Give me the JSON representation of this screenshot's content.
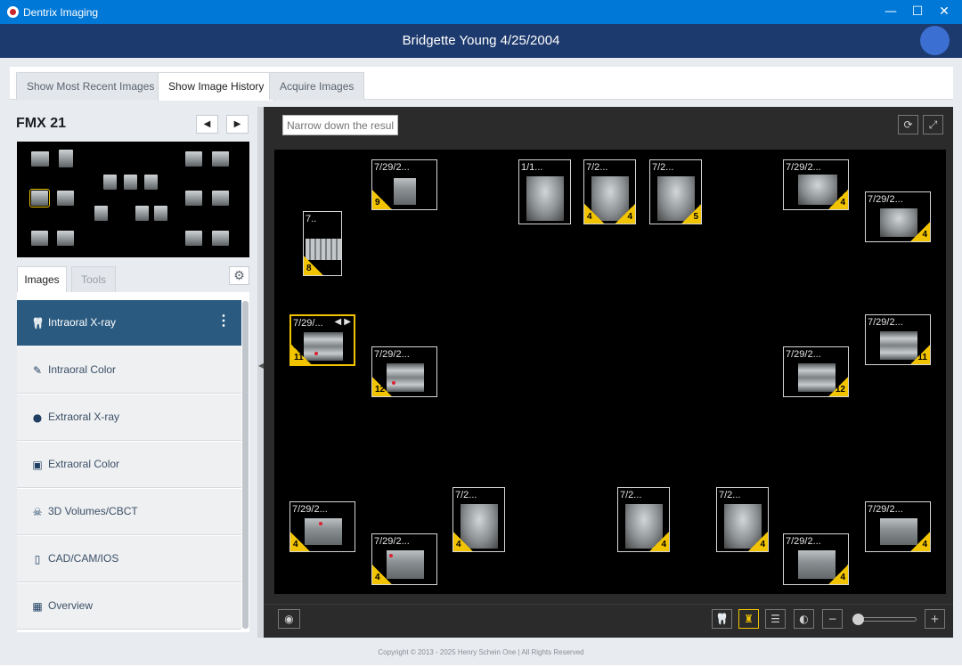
{
  "window": {
    "title": "Dentrix Imaging",
    "minimize_glyph": "—",
    "maximize_glyph": "☐",
    "close_glyph": "✕"
  },
  "header": {
    "patient": "Bridgette Young 4/25/2004"
  },
  "tabs": [
    {
      "label": "Show Most Recent Images",
      "active": false
    },
    {
      "label": "Show Image History",
      "active": true
    },
    {
      "label": "Acquire Images",
      "active": false
    }
  ],
  "fmx": {
    "title": "FMX 21",
    "prev_glyph": "◀",
    "next_glyph": "▶"
  },
  "subtabs": {
    "images": "Images",
    "tools": "Tools",
    "gear_glyph": "⚙"
  },
  "categories": [
    {
      "label": "Intraoral X-ray",
      "icon": "tooth-icon",
      "glyph": "🦷",
      "active": true
    },
    {
      "label": "Intraoral Color",
      "icon": "intraoral-camera-icon",
      "glyph": "✎"
    },
    {
      "label": "Extraoral X-ray",
      "icon": "head-profile-icon",
      "glyph": "●"
    },
    {
      "label": "Extraoral Color",
      "icon": "camera-icon",
      "glyph": "▣"
    },
    {
      "label": "3D Volumes/CBCT",
      "icon": "skull-icon",
      "glyph": "☠"
    },
    {
      "label": "CAD/CAM/IOS",
      "icon": "scanner-icon",
      "glyph": "▯"
    },
    {
      "label": "Overview",
      "icon": "grid-icon",
      "glyph": "▦"
    }
  ],
  "kebab_glyph": "⋮",
  "viewer": {
    "filter_placeholder": "Narrow down the results",
    "refresh_glyph": "⟳",
    "fullscreen_glyph": "⤢",
    "view_glyph": "◉",
    "minus_glyph": "−",
    "plus_glyph": "+",
    "tool_tooth_glyph": "🦷",
    "tool_crown_glyph": "♜",
    "tool_adjust_glyph": "☰",
    "tool_contrast_glyph": "◐"
  },
  "xrays": [
    {
      "date": "7/29/2...",
      "count": "9",
      "corner": "left"
    },
    {
      "date": "7..",
      "count": "8",
      "corner": "left"
    },
    {
      "date": "1/1...",
      "count": "",
      "corner": ""
    },
    {
      "date": "7/2...",
      "count": "4",
      "corner": "both",
      "count2": "4"
    },
    {
      "date": "7/2...",
      "count": "5",
      "corner": "right"
    },
    {
      "date": "7/29/2...",
      "count": "4",
      "corner": "right"
    },
    {
      "date": "7/29/2...",
      "count": "4",
      "corner": "right"
    },
    {
      "date": "7/29/...",
      "count": "11",
      "corner": "left",
      "selected": true,
      "arrows": "◀ ▶"
    },
    {
      "date": "7/29/2...",
      "count": "12",
      "corner": "left"
    },
    {
      "date": "7/29/2...",
      "count": "12",
      "corner": "right"
    },
    {
      "date": "7/29/2...",
      "count": "11",
      "corner": "right"
    },
    {
      "date": "7/29/2...",
      "count": "4",
      "corner": "left"
    },
    {
      "date": "7/29/2...",
      "count": "4",
      "corner": "left"
    },
    {
      "date": "7/2...",
      "count": "4",
      "corner": "left"
    },
    {
      "date": "7/2...",
      "count": "4",
      "corner": "right"
    },
    {
      "date": "7/2...",
      "count": "4",
      "corner": "right"
    },
    {
      "date": "7/29/2...",
      "count": "4",
      "corner": "right"
    },
    {
      "date": "7/29/2...",
      "count": "4",
      "corner": "right"
    }
  ],
  "footer": "Copyright © 2013 - 2025 Henry Schein One | All Rights Reserved"
}
